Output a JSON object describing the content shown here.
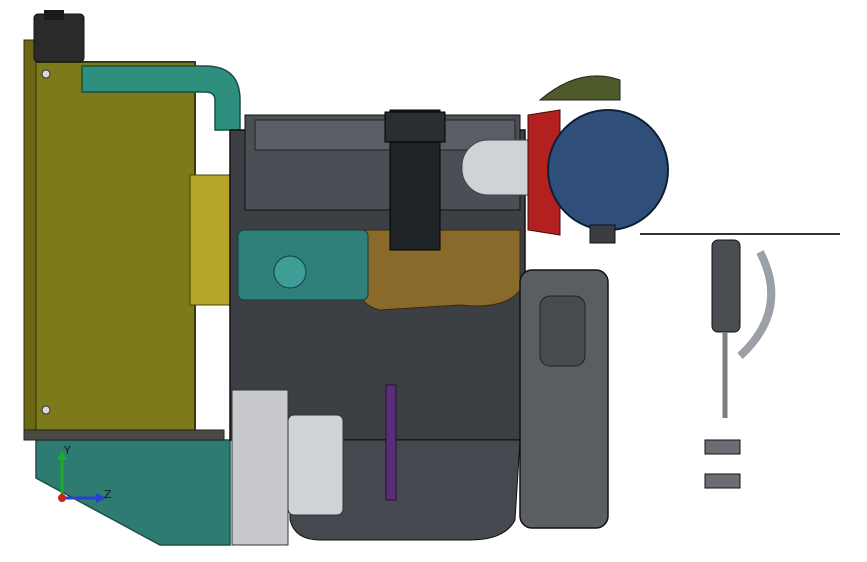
{
  "viewport": {
    "background": "#ffffff",
    "colors": {
      "radiator": "#7d7a1a",
      "pipe": "#2f8f7f",
      "block": "#3c3f44",
      "turbo_blue": "#2f4f7a",
      "air_cleaner": "#4e5a2a",
      "red_flange": "#b32020",
      "brass": "#8a6a2a",
      "teal_pump": "#2f7f7a",
      "base": "#2e7b72",
      "purple_rod": "#5a2d7a"
    }
  },
  "triad": {
    "y_label": "Y",
    "z_label": "Z",
    "colors": {
      "y": "#1faa2a",
      "z": "#2a3fd0",
      "x": "#cc2020"
    }
  }
}
